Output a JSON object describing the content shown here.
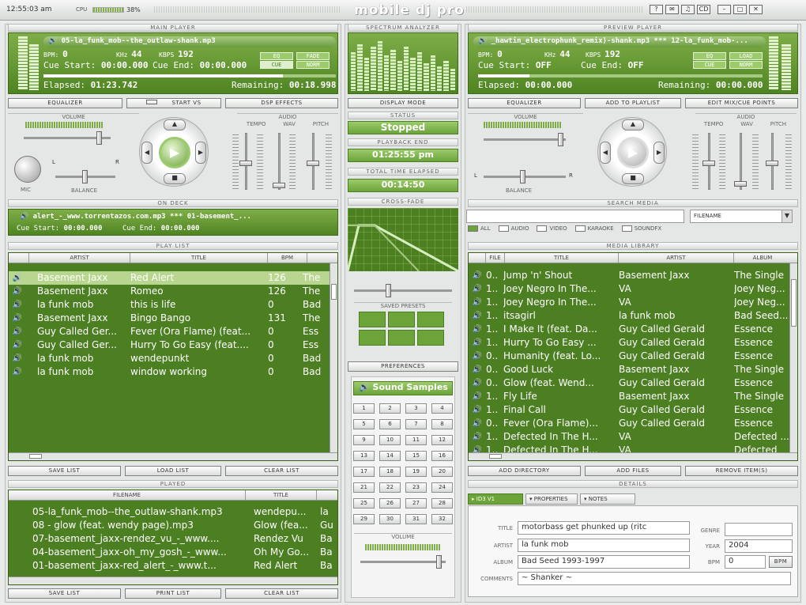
{
  "topbar": {
    "time": "12:55:03 am",
    "cpu_label": "CPU",
    "cpu_value": "38%",
    "logo": "mobile dj pro",
    "win_icons": [
      "?",
      "✉",
      "♫",
      "CD",
      "–",
      "□",
      "✕"
    ]
  },
  "sections": {
    "main_player": "MAIN PLAYER",
    "spectrum": "SPECTRUM ANALYZER",
    "preview_player": "PREVIEW PLAYER",
    "volume": "VOLUME",
    "audio": "AUDIO",
    "status": "STATUS",
    "playback_end": "PLAYBACK END",
    "total_elapsed": "TOTAL TIME ELAPSED",
    "crossfade": "CROSS-FADE",
    "saved_presets": "SAVED PRESETS",
    "on_deck": "ON DECK",
    "play_list": "PLAY LIST",
    "played": "PLAYED",
    "search_media": "SEARCH MEDIA",
    "media_library": "MEDIA LIBRARY",
    "details": "DETAILS",
    "sound_volume": "VOLUME"
  },
  "main_player": {
    "track": "05-la_funk_mob--the_outlaw-shank.mp3",
    "bpm_label": "BPM:",
    "bpm": "0",
    "khz_label": "KHz",
    "khz": "44",
    "kbps_label": "KBPS",
    "kbps": "192",
    "cue_start_label": "Cue Start:",
    "cue_start": "00:00.000",
    "cue_end_label": "Cue End:",
    "cue_end": "00:00.000",
    "eq": "EQ",
    "fade": "FADE",
    "cue": "CUE",
    "norm": "NORM",
    "elapsed_label": "Elapsed:",
    "elapsed": "01:23.742",
    "remaining_label": "Remaining:",
    "remaining": "00:18.998",
    "progress": 0.82,
    "buttons": {
      "equalizer": "EQUALIZER",
      "start_vs": "START VS",
      "dsp": "DSP EFFECTS"
    },
    "audio_labels": [
      "TEMPO",
      "WAV",
      "PITCH"
    ],
    "mic": "MIC",
    "balance": "BALANCE",
    "l": "L",
    "r": "R"
  },
  "spectrum_bars": [
    0.7,
    0.85,
    0.6,
    0.8,
    0.9,
    0.65,
    0.75,
    0.55,
    0.8,
    0.6,
    0.7,
    0.5,
    0.65,
    0.45,
    0.55,
    0.4
  ],
  "center": {
    "display_mode": "DISPLAY MODE",
    "status": "Stopped",
    "playback_end": "01:25:55 pm",
    "total_elapsed": "00:14:50",
    "preferences": "PREFERENCES",
    "sound_samples": "Sound Samples",
    "pads": [
      "1",
      "2",
      "3",
      "4",
      "5",
      "6",
      "7",
      "8",
      "9",
      "10",
      "11",
      "12",
      "13",
      "14",
      "15",
      "16",
      "17",
      "18",
      "19",
      "20",
      "21",
      "22",
      "23",
      "24",
      "25",
      "26",
      "27",
      "28",
      "29",
      "30",
      "31",
      "32"
    ]
  },
  "on_deck": {
    "track": "alert_-_www.torrentazos.com.mp3 *** 01-basement_...",
    "cue_start_label": "Cue Start:",
    "cue_start": "00:00.000",
    "cue_end_label": "Cue End:",
    "cue_end": "00:00.000"
  },
  "playlist": {
    "columns": [
      "ARTIST",
      "TITLE",
      "BPM"
    ],
    "rows": [
      {
        "artist": "Basement Jaxx",
        "title": "Red Alert",
        "bpm": "126",
        "album": "The"
      },
      {
        "artist": "Basement Jaxx",
        "title": "Romeo",
        "bpm": "126",
        "album": "The"
      },
      {
        "artist": "la funk mob",
        "title": "this is life",
        "bpm": "0",
        "album": "Bad"
      },
      {
        "artist": "Basement Jaxx",
        "title": "Bingo Bango",
        "bpm": "131",
        "album": "The"
      },
      {
        "artist": "Guy Called Ger...",
        "title": "Fever (Ora Flame) (feat...",
        "bpm": "0",
        "album": "Ess"
      },
      {
        "artist": "Guy Called Ger...",
        "title": "Hurry To Go Easy (feat....",
        "bpm": "0",
        "album": "Ess"
      },
      {
        "artist": "la funk mob",
        "title": "wendepunkt",
        "bpm": "0",
        "album": "Bad"
      },
      {
        "artist": "la funk mob",
        "title": "window working",
        "bpm": "0",
        "album": "Bad"
      }
    ],
    "buttons": {
      "save": "SAVE LIST",
      "load": "LOAD LIST",
      "clear": "CLEAR LIST"
    }
  },
  "played": {
    "columns": [
      "FILENAME",
      "TITLE"
    ],
    "rows": [
      {
        "file": "05-la_funk_mob--the_outlaw-shank.mp3",
        "title": "wendepu...",
        "x": "la"
      },
      {
        "file": "08 - glow (feat. wendy page).mp3",
        "title": "Glow (fea...",
        "x": "Gu"
      },
      {
        "file": "07-basement_jaxx-rendez_vu_-_www....",
        "title": "Rendez Vu",
        "x": "Ba"
      },
      {
        "file": "04-basement_jaxx-oh_my_gosh_-_www...",
        "title": "Oh My Go...",
        "x": "Ba"
      },
      {
        "file": "01-basement_jaxx-red_alert_-_www.t...",
        "title": "Red Alert",
        "x": "Ba"
      }
    ],
    "buttons": {
      "save": "SAVE LIST",
      "print": "PRINT LIST",
      "clear": "CLEAR LIST"
    }
  },
  "preview_player": {
    "track": "_hawtin_electrophunk_remix)-shank.mp3 *** 12-la_funk_mob-...",
    "bpm_label": "BPM:",
    "bpm": "0",
    "khz_label": "KHz",
    "khz": "44",
    "kbps_label": "KBPS",
    "kbps": "192",
    "cue_start_label": "Cue Start:",
    "cue_start": "OFF",
    "cue_end_label": "Cue End:",
    "cue_end": "OFF",
    "eq": "EQ",
    "load": "LOAD",
    "cue": "CUE",
    "norm": "NORM",
    "elapsed_label": "Elapsed:",
    "elapsed": "00:00.000",
    "remaining_label": "Remaining:",
    "remaining": "00:00.000",
    "progress": 0.18,
    "buttons": {
      "equalizer": "EQUALIZER",
      "add_playlist": "ADD TO PLAYLIST",
      "edit_cue": "EDIT MIX/CUE POINTS"
    }
  },
  "search": {
    "value": "",
    "filter": "FILENAME",
    "types": [
      {
        "label": "ALL",
        "on": true
      },
      {
        "label": "AUDIO",
        "on": false
      },
      {
        "label": "VIDEO",
        "on": false
      },
      {
        "label": "KARAOKE",
        "on": false
      },
      {
        "label": "SOUNDFX",
        "on": false
      }
    ]
  },
  "library": {
    "columns": [
      "FILE",
      "TITLE",
      "ARTIST",
      "ALBUM"
    ],
    "rows": [
      {
        "file": "0..",
        "title": "Jump 'n' Shout",
        "artist": "Basement Jaxx",
        "album": "The Single"
      },
      {
        "file": "1..",
        "title": "Joey Negro In The...",
        "artist": "VA",
        "album": "Joey Neg..."
      },
      {
        "file": "1..",
        "title": "Joey Negro In The...",
        "artist": "VA",
        "album": "Joey Neg..."
      },
      {
        "file": "1..",
        "title": "itsagirl",
        "artist": "la funk mob",
        "album": "Bad Seed..."
      },
      {
        "file": "1..",
        "title": "I Make It (feat. Da...",
        "artist": "Guy Called Gerald",
        "album": "Essence"
      },
      {
        "file": "1..",
        "title": "Hurry To Go Easy ...",
        "artist": "Guy Called Gerald",
        "album": "Essence"
      },
      {
        "file": "0..",
        "title": "Humanity (feat. Lo...",
        "artist": "Guy Called Gerald",
        "album": "Essence"
      },
      {
        "file": "0..",
        "title": "Good Luck",
        "artist": "Basement Jaxx",
        "album": "The Single"
      },
      {
        "file": "0..",
        "title": "Glow (feat. Wend...",
        "artist": "Guy Called Gerald",
        "album": "Essence"
      },
      {
        "file": "1..",
        "title": "Fly Life",
        "artist": "Basement Jaxx",
        "album": "The Single"
      },
      {
        "file": "1..",
        "title": "Final Call",
        "artist": "Guy Called Gerald",
        "album": "Essence"
      },
      {
        "file": "0..",
        "title": "Fever (Ora Flame)...",
        "artist": "Guy Called Gerald",
        "album": "Essence"
      },
      {
        "file": "1..",
        "title": "Defected In The H...",
        "artist": "VA",
        "album": "Defected ..."
      },
      {
        "file": "1..",
        "title": "Defected In The H...",
        "artist": "VA",
        "album": "Defected"
      }
    ],
    "buttons": {
      "add_dir": "ADD DIRECTORY",
      "add_files": "ADD FILES",
      "remove": "REMOVE ITEM(S)"
    }
  },
  "details": {
    "tabs": [
      "ID3 V1",
      "PROPERTIES",
      "NOTES"
    ],
    "title_label": "TITLE",
    "title": "motorbass get phunked up (ritc",
    "artist_label": "ARTIST",
    "artist": "la funk mob",
    "album_label": "ALBUM",
    "album": "Bad Seed 1993-1997",
    "comments_label": "COMMENTS",
    "comments": "~ Shanker ~",
    "genre_label": "GENRE",
    "genre": "",
    "year_label": "YEAR",
    "year": "2004",
    "bpm_label": "BPM",
    "bpm": "0",
    "bpm_btn": "BPM"
  }
}
